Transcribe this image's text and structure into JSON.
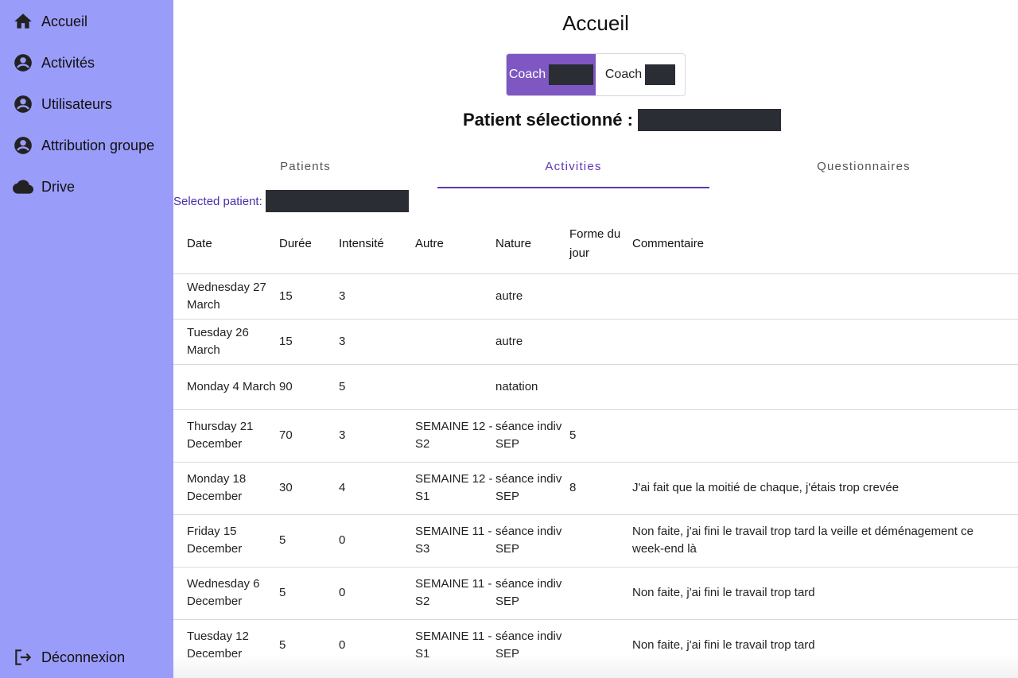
{
  "sidebar": {
    "items": [
      {
        "label": "Accueil",
        "icon": "home-icon"
      },
      {
        "label": "Activités",
        "icon": "account-circle-icon"
      },
      {
        "label": "Utilisateurs",
        "icon": "account-circle-icon"
      },
      {
        "label": "Attribution groupe",
        "icon": "account-circle-icon"
      },
      {
        "label": "Drive",
        "icon": "cloud-icon"
      }
    ],
    "logout": {
      "label": "Déconnexion",
      "icon": "logout-icon"
    },
    "color": "#9a9cfa"
  },
  "page": {
    "title": "Accueil"
  },
  "coaches": [
    {
      "label": "Coach",
      "active": true
    },
    {
      "label": "Coach",
      "active": false
    }
  ],
  "selected_patient_title": "Patient sélectionné :",
  "tabs": [
    {
      "label": "Patients",
      "active": false
    },
    {
      "label": "Activities",
      "active": true
    },
    {
      "label": "Questionnaires",
      "active": false
    }
  ],
  "selected_patient_label": "Selected patient:",
  "accent_color": "#7e57c2",
  "table": {
    "headers": [
      "Date",
      "Durée",
      "Intensité",
      "Autre",
      "Nature",
      "Forme du jour",
      "Commentaire"
    ],
    "rows": [
      [
        "Wednesday 27 March",
        "15",
        "3",
        "",
        "autre",
        "",
        ""
      ],
      [
        "Tuesday 26 March",
        "15",
        "3",
        "",
        "autre",
        "",
        ""
      ],
      [
        "Monday 4 March",
        "90",
        "5",
        "",
        "natation",
        "",
        ""
      ],
      [
        "Thursday 21 December",
        "70",
        "3",
        "SEMAINE 12 - S2",
        "séance indiv SEP",
        "5",
        ""
      ],
      [
        "Monday 18 December",
        "30",
        "4",
        "SEMAINE 12 - S1",
        "séance indiv SEP",
        "8",
        "J'ai fait que la moitié de chaque, j'étais trop crevée"
      ],
      [
        "Friday 15 December",
        "5",
        "0",
        "SEMAINE 11 - S3",
        "séance indiv SEP",
        "",
        "Non faite, j'ai fini le travail trop tard la veille et déménagement ce week-end là"
      ],
      [
        "Wednesday 6 December",
        "5",
        "0",
        "SEMAINE 11 - S2",
        "séance indiv SEP",
        "",
        "Non faite, j'ai fini le travail trop tard"
      ],
      [
        "Tuesday 12 December",
        "5",
        "0",
        "SEMAINE 11 - S1",
        "séance indiv SEP",
        "",
        "Non faite, j'ai fini le travail trop tard"
      ]
    ]
  }
}
